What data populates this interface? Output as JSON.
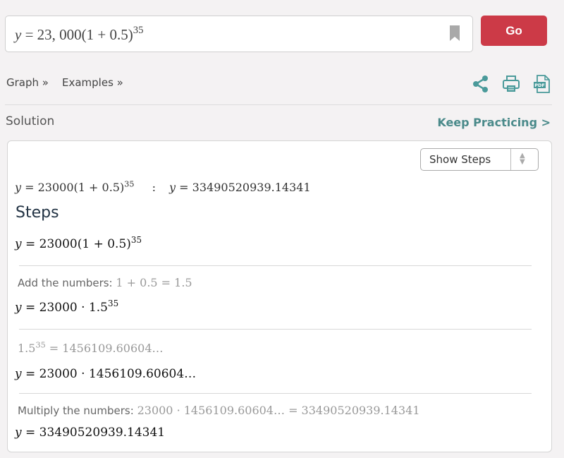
{
  "search": {
    "expression_prefix_var": "y",
    "expression_prefix": " = 23, 000(1 + 0.5)",
    "expression_exponent": "35",
    "go_label": "Go",
    "bookmark_icon": "bookmark-icon"
  },
  "subnav": {
    "graph_label": "Graph »",
    "examples_label": "Examples »",
    "icons": [
      "share-icon",
      "print-icon",
      "pdf-icon"
    ]
  },
  "colors": {
    "accent_teal": "#4a9a9a",
    "go_red": "#cc3a47"
  },
  "solution": {
    "label": "Solution",
    "keep_practicing_label": "Keep Practicing >",
    "show_steps_label": "Show Steps",
    "summary": {
      "lhs_var": "y",
      "lhs": " = 23000(1 + 0.5)",
      "lhs_exp": "35",
      "colon": ":",
      "rhs_var": "y",
      "rhs": " = 33490520939.14341"
    },
    "steps_title": "Steps",
    "initial": {
      "var": "y",
      "base": " = 23000(1 + 0.5)",
      "exp": "35"
    },
    "steps": [
      {
        "hint_text": "Add the numbers: ",
        "hint_math": "1 + 0.5 = 1.5",
        "result_var": "y",
        "result_base": " = 23000 ·  1.5",
        "result_exp": "35"
      },
      {
        "hint_math_base": "1.5",
        "hint_math_exp": "35",
        "hint_math_rest": " = 1456109.60604…",
        "result_var": "y",
        "result_base": " = 23000 ·  1456109.60604…"
      },
      {
        "hint_text": "Multiply the numbers: ",
        "hint_math": "23000 ·  1456109.60604… = 33490520939.14341",
        "result_var": "y",
        "result_base": " = 33490520939.14341"
      }
    ]
  }
}
